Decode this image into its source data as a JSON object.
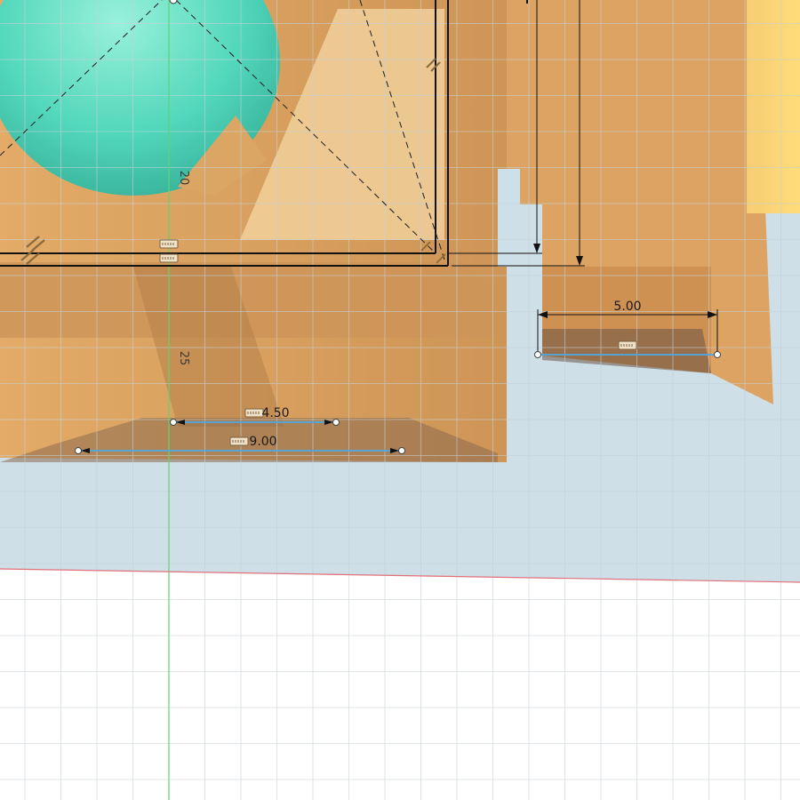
{
  "app": {
    "view": "sketch-canvas"
  },
  "grid": {
    "axis_labels": [
      "20",
      "25"
    ]
  },
  "dimensions": [
    {
      "id": "dim-5",
      "label": "5.00"
    },
    {
      "id": "dim-4-5",
      "label": "4.50"
    },
    {
      "id": "dim-9",
      "label": "9.00"
    }
  ],
  "colors": {
    "grid_line": "#d6dde1",
    "y_axis": "#5cd66a",
    "x_axis": "#e0707a",
    "sketch_line": "#111111",
    "construction_line": "#2b2b2b",
    "selected_line": "#4ba8e6",
    "canvas_background": "#ffffff"
  },
  "icons": [
    "horizontal-constraint-icon",
    "parallel-constraint-icon",
    "point-handle-icon"
  ]
}
